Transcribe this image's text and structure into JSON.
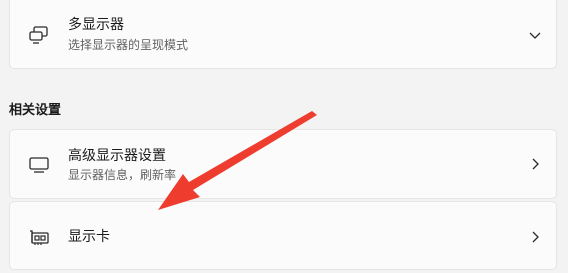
{
  "multi_display": {
    "title": "多显示器",
    "subtitle": "选择显示器的呈现模式",
    "icon": "multiple-displays-icon",
    "chevron": "chevron-down-icon"
  },
  "related_settings": {
    "header": "相关设置",
    "items": [
      {
        "title": "高级显示器设置",
        "subtitle": "显示器信息，刷新率",
        "icon": "monitor-icon",
        "chevron": "chevron-right-icon"
      },
      {
        "title": "显示卡",
        "icon": "graphics-card-icon",
        "chevron": "chevron-right-icon"
      }
    ]
  },
  "annotation": {
    "color": "#ee3c2e"
  }
}
